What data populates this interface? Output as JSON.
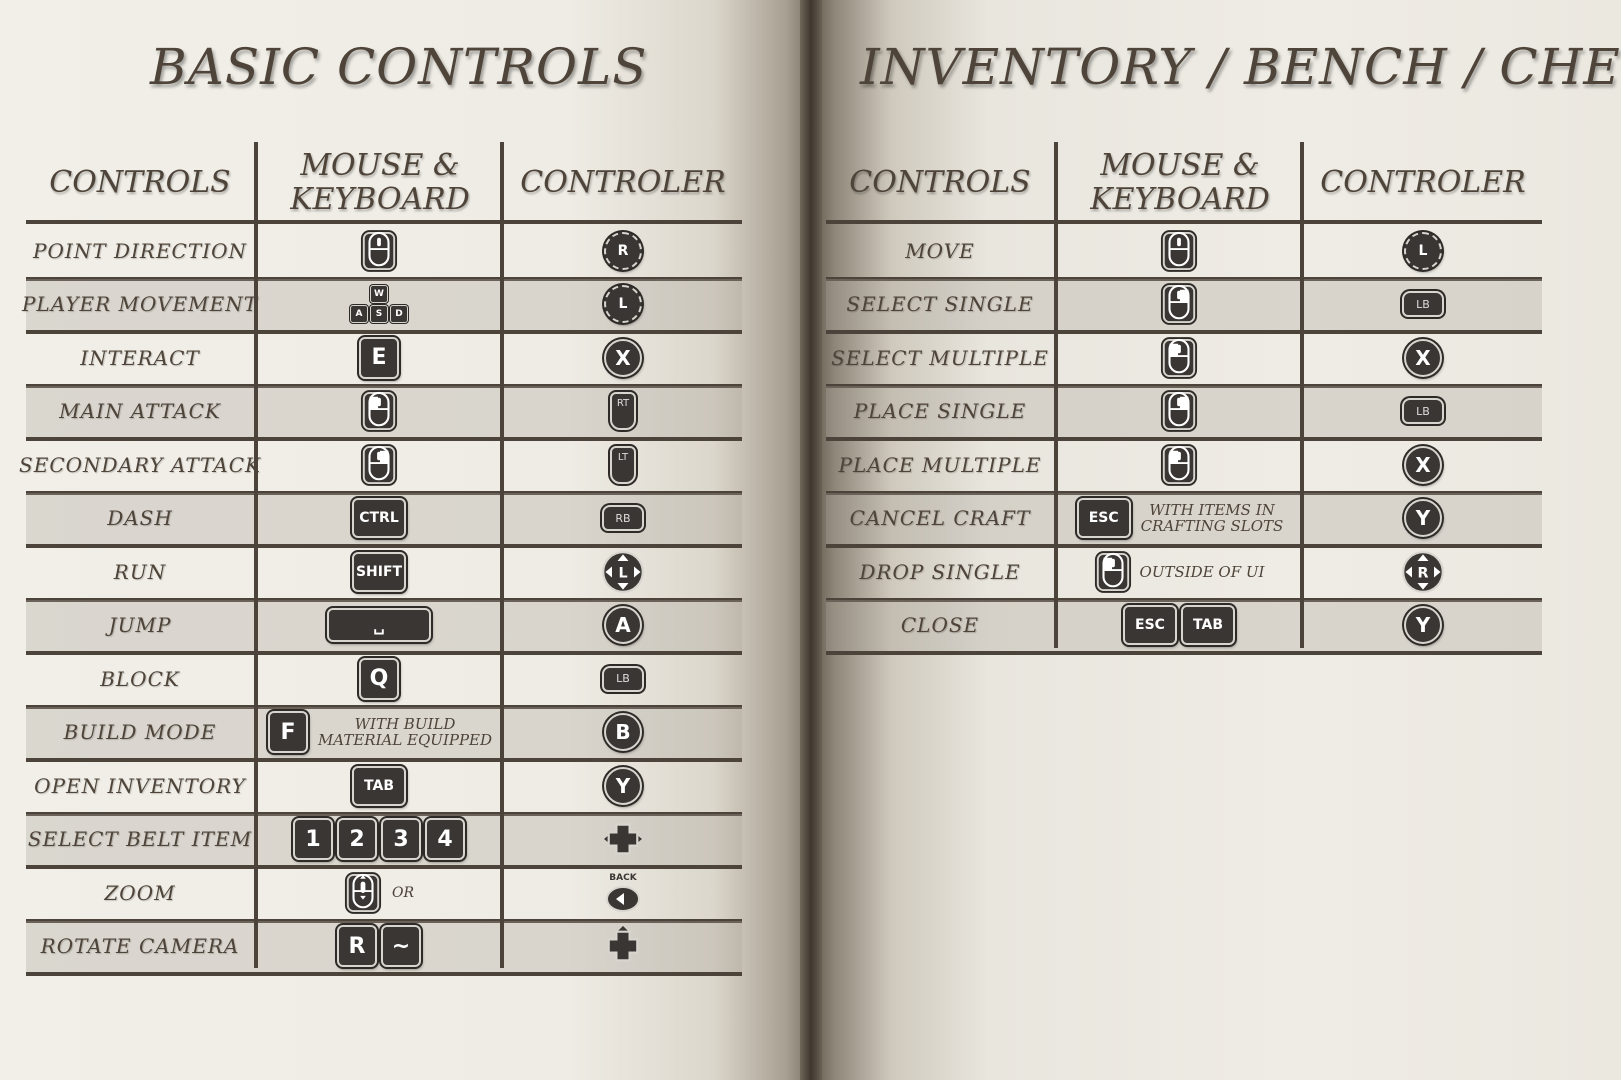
{
  "left": {
    "title": "BASIC CONTROLS",
    "headers": {
      "controls": "CONTROLS",
      "mk_line1": "MOUSE &",
      "mk_line2": "KEYBOARD",
      "controller": "CONTROLER"
    },
    "rows": [
      {
        "label": "POINT DIRECTION",
        "mk": "mouse-icon",
        "ctrl": "R"
      },
      {
        "label": "PLAYER MOVEMENT",
        "mk": [
          "W",
          "A",
          "S",
          "D"
        ],
        "ctrl": "L"
      },
      {
        "label": "INTERACT",
        "mk": "E",
        "ctrl": "X"
      },
      {
        "label": "MAIN ATTACK",
        "mk": "mouse-left-click-icon",
        "ctrl": "RT"
      },
      {
        "label": "SECONDARY ATTACK",
        "mk": "mouse-right-click-icon",
        "ctrl": "LT"
      },
      {
        "label": "DASH",
        "mk": "CTRL",
        "ctrl": "RB"
      },
      {
        "label": "RUN",
        "mk": "SHIFT",
        "ctrl": "L"
      },
      {
        "label": "JUMP",
        "mk": "␣",
        "ctrl": "A"
      },
      {
        "label": "BLOCK",
        "mk": "Q",
        "ctrl": "LB"
      },
      {
        "label": "BUILD MODE",
        "mk": "F",
        "note1": "WITH BUILD",
        "note2": "MATERIAL EQUIPPED",
        "ctrl": "B"
      },
      {
        "label": "OPEN INVENTORY",
        "mk": "TAB",
        "ctrl": "Y"
      },
      {
        "label": "SELECT BELT ITEM",
        "mk": [
          "1",
          "2",
          "3",
          "4"
        ],
        "ctrl": "dpad-left-right-icon"
      },
      {
        "label": "ZOOM",
        "mk": "mouse-scroll-icon",
        "or": "OR",
        "ctrl_label": "BACK"
      },
      {
        "label": "ROTATE CAMERA",
        "mk": [
          "R",
          "~"
        ],
        "ctrl": "dpad-up-icon"
      }
    ]
  },
  "right": {
    "title": "INVENTORY / BENCH / CHEST",
    "headers": {
      "controls": "CONTROLS",
      "mk_line1": "MOUSE &",
      "mk_line2": "KEYBOARD",
      "controller": "CONTROLER"
    },
    "rows": [
      {
        "label": "MOVE",
        "mk": "mouse-icon",
        "ctrl": "L"
      },
      {
        "label": "SELECT SINGLE",
        "mk": "mouse-right-click-icon",
        "ctrl": "LB"
      },
      {
        "label": "SELECT MULTIPLE",
        "mk": "mouse-left-click-icon",
        "ctrl": "X"
      },
      {
        "label": "PLACE SINGLE",
        "mk": "mouse-right-click-icon",
        "ctrl": "LB"
      },
      {
        "label": "PLACE MULTIPLE",
        "mk": "mouse-left-click-icon",
        "ctrl": "X"
      },
      {
        "label": "CANCEL CRAFT",
        "mk": "ESC",
        "note1": "WITH ITEMS IN",
        "note2": "CRAFTING SLOTS",
        "ctrl": "Y"
      },
      {
        "label": "DROP SINGLE",
        "mk": "mouse-left-click-icon",
        "note1": "OUTSIDE OF UI",
        "ctrl": "R"
      },
      {
        "label": "CLOSE",
        "mk": [
          "ESC",
          "TAB"
        ],
        "ctrl": "Y"
      }
    ]
  },
  "colors": {
    "ink": "#4e4439",
    "rule": "#4c433a",
    "key": "#3a3633",
    "shade": "#c9c5bc"
  }
}
